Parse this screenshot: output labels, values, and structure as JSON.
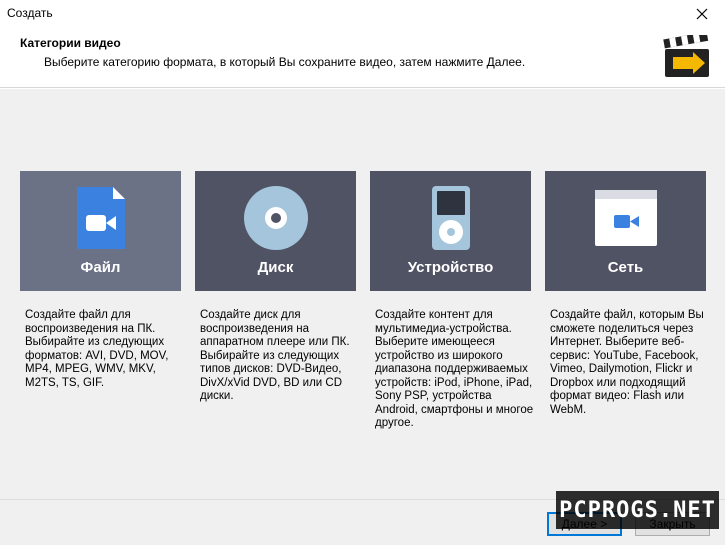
{
  "window": {
    "title": "Создать"
  },
  "header": {
    "title": "Категории видео",
    "subtitle": "Выберите категорию формата, в который Вы сохраните видео, затем нажмите Далее."
  },
  "cards": [
    {
      "label": "Файл",
      "icon": "file-video-icon",
      "description": "Создайте файл для воспроизведения на ПК. Выбирайте из следующих форматов: AVI, DVD, MOV, MP4, MPEG, WMV, MKV, M2TS, TS, GIF."
    },
    {
      "label": "Диск",
      "icon": "disc-icon",
      "description": "Создайте диск для воспроизведения на аппаратном плеере или ПК. Выбирайте из следующих типов дисков: DVD-Видео, DivX/xVid DVD, BD или CD диски."
    },
    {
      "label": "Устройство",
      "icon": "media-player-icon",
      "description": "Создайте контент для мультимедиа-устройства. Выберите имеющееся устройство из широкого диапазона поддерживаемых устройств: iPod, iPhone, iPad, Sony PSP, устройства Android, смартфоны и многое другое."
    },
    {
      "label": "Сеть",
      "icon": "web-video-icon",
      "description": "Создайте файл, которым Вы сможете поделиться через Интернет. Выберите веб-сервис: YouTube, Facebook, Vimeo, Dailymotion, Flickr и Dropbox или подходящий формат видео: Flash или WebM."
    }
  ],
  "footer": {
    "next_label": "Далее >",
    "close_label": "Закрыть"
  },
  "watermark": "PCPROGS.NET",
  "colors": {
    "card_bg": "#4f5364",
    "card_selected": "#6b7285",
    "accent_blue": "#3b82e0"
  }
}
